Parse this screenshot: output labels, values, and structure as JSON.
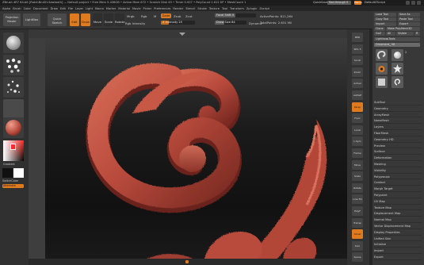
{
  "titlebar": {
    "app_title": "ZBrush 4R7 64-bit [RatchBruSH-Sawtooth] — Default project • Free Mem 5.436GB • Active Mem 672 • Scratch Disk 49 • Timer 0.007 • PolyCount 1.612 KP • MeshCount 1",
    "quicksave": "QuickSave",
    "seethrough": "See-through  0",
    "menus": "Menus",
    "default_script": "DefaultZScript"
  },
  "menubar": [
    "Alpha",
    "Brush",
    "Color",
    "Document",
    "Draw",
    "Edit",
    "File",
    "Layer",
    "Light",
    "Macro",
    "Marker",
    "Material",
    "Movie",
    "Picker",
    "Preferences",
    "Render",
    "Stencil",
    "Stroke",
    "Texture",
    "Tool",
    "Transform",
    "Zplugin",
    "Zscript"
  ],
  "shelf": {
    "projection_master": "Projection Master",
    "lightbox": "LightBox",
    "quick_sketch": "Quick Sketch",
    "edit": "Edit",
    "draw": "Draw",
    "move": "Move",
    "scale": "Scale",
    "rotate": "Rotate",
    "mrgb": "Mrgb",
    "rgb": "Rgb",
    "m": "M",
    "zadd": "Zadd",
    "zsub": "Zsub",
    "zcut": "Zcut",
    "rgb_intensity": "Rgb Intensity",
    "z_intensity": "Z Intensity 25",
    "focal_shift": "Focal Shift 0",
    "draw_size": "Draw Size 64",
    "dynamic": "Dynamic",
    "active_points": "ActivePoints: 811,264",
    "total_points": "TotalPoints: 2.631 Mil"
  },
  "left_shelf": {
    "gradient_label": "Gradient",
    "switch_color": "SwitchColor",
    "alternate": "Alternate",
    "tool_colors": {
      "material": "#b84a3c",
      "color_swatch_main": "#ff2a2a",
      "color_primary": "#111111",
      "color_secondary": "#ffffff"
    }
  },
  "right_shelf": {
    "tools": [
      "BPR",
      "SPix 3",
      "Scroll",
      "Zoom",
      "Actual",
      "AAHalf",
      "Persp",
      "Floor",
      "Local",
      "L.Sym",
      "Frame",
      "Move",
      "Scale",
      "Rotate",
      "Line Fill",
      "PolyF",
      "Transp",
      "Ghost",
      "Solo",
      "Xpose"
    ],
    "highlight_color": "#e07a1e"
  },
  "tool_panel": {
    "top_buttons": [
      "Load Tool",
      "Save As",
      "Copy Tool",
      "Paste Tool",
      "Import",
      "Export",
      "Clone",
      "Make PolyMesh3D",
      "GoZ",
      "All",
      "Visible",
      "R"
    ],
    "lightbox_tools": "Lightbox▸Tools",
    "current_tool": "Ornament_ 58",
    "thumb_count": "2",
    "sections": [
      "SubTool",
      "Geometry",
      "ArrayMesh",
      "NanoMesh",
      "Layers",
      "FiberMesh",
      "Geometry HD",
      "Preview",
      "Surface",
      "Deformation",
      "Masking",
      "Visibility",
      "Polygroups",
      "Contact",
      "Morph Target",
      "Polypaint",
      "UV Map",
      "Texture Map",
      "Displacement Map",
      "Normal Map",
      "Vector Displacement Map",
      "Display Properties",
      "Unified Skin",
      "Initialize",
      "Import",
      "Export"
    ]
  },
  "viewport": {
    "model_color": "#c0503e",
    "background_top": "#3d3d3d",
    "background_bottom": "#111111"
  }
}
